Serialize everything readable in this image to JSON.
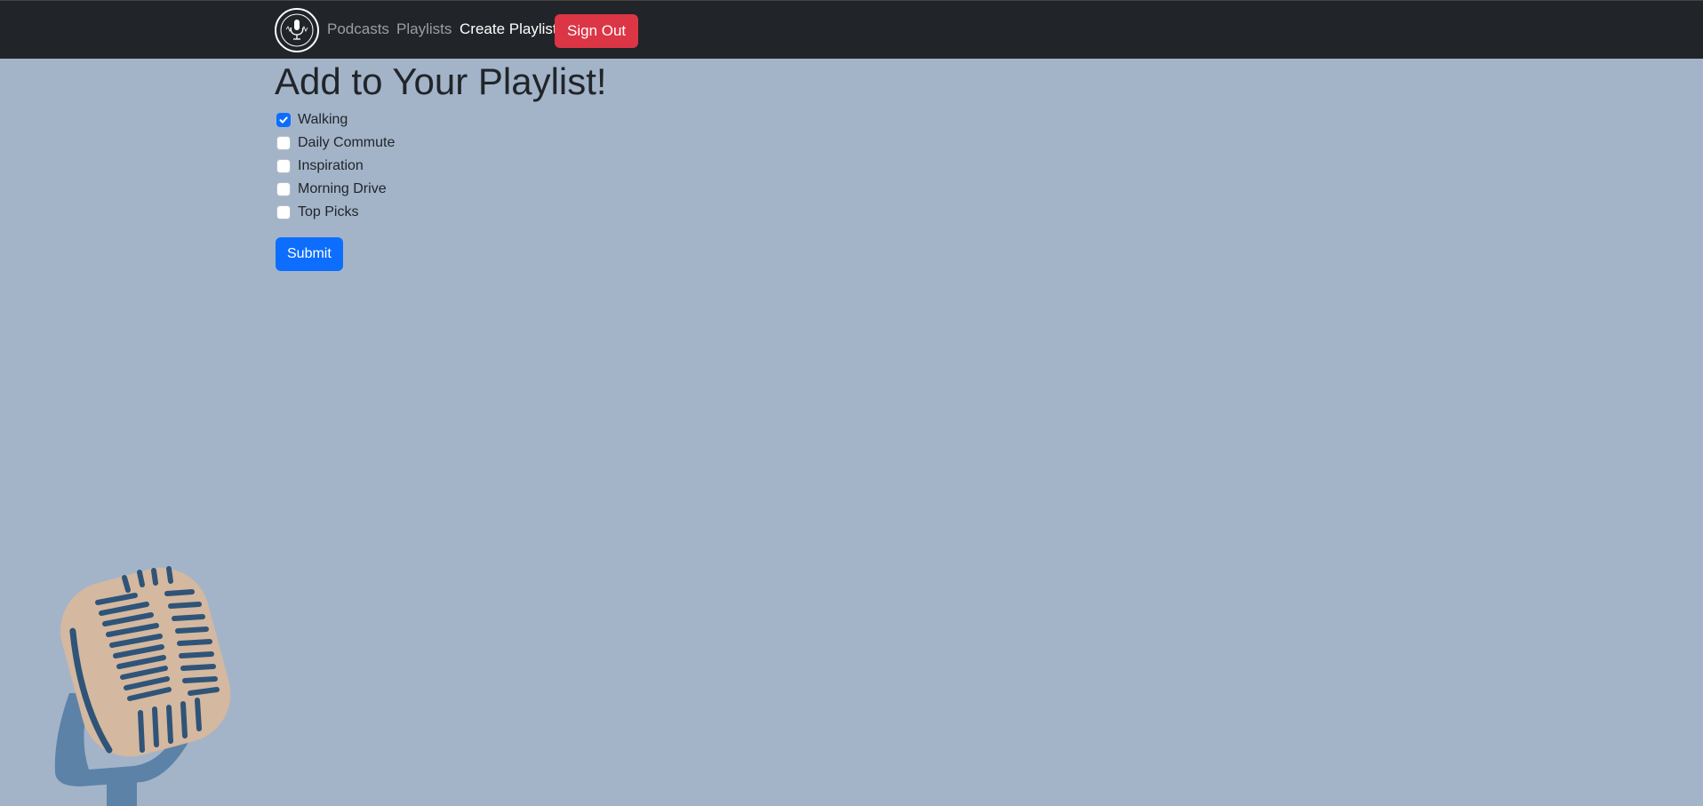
{
  "nav": {
    "logo_icon": "podcast-microphone-logo",
    "links": [
      {
        "label": "Podcasts",
        "active": false
      },
      {
        "label": "Playlists",
        "active": false
      },
      {
        "label": "Create Playlist",
        "active": true
      }
    ],
    "signout_label": "Sign Out"
  },
  "main": {
    "title": "Add to Your Playlist!",
    "playlists": [
      {
        "label": "Walking",
        "checked": true
      },
      {
        "label": "Daily Commute",
        "checked": false
      },
      {
        "label": "Inspiration",
        "checked": false
      },
      {
        "label": "Morning Drive",
        "checked": false
      },
      {
        "label": "Top Picks",
        "checked": false
      }
    ],
    "submit_label": "Submit"
  },
  "decor": {
    "illustration_icon": "microphone-illustration"
  },
  "colors": {
    "background": "#a3b4c9",
    "navbar": "#212529",
    "primary": "#0d6efd",
    "danger": "#dc3545",
    "mic_head": "#d4b8a0",
    "mic_lines": "#2f5478",
    "mic_stand": "#5d82a8"
  }
}
